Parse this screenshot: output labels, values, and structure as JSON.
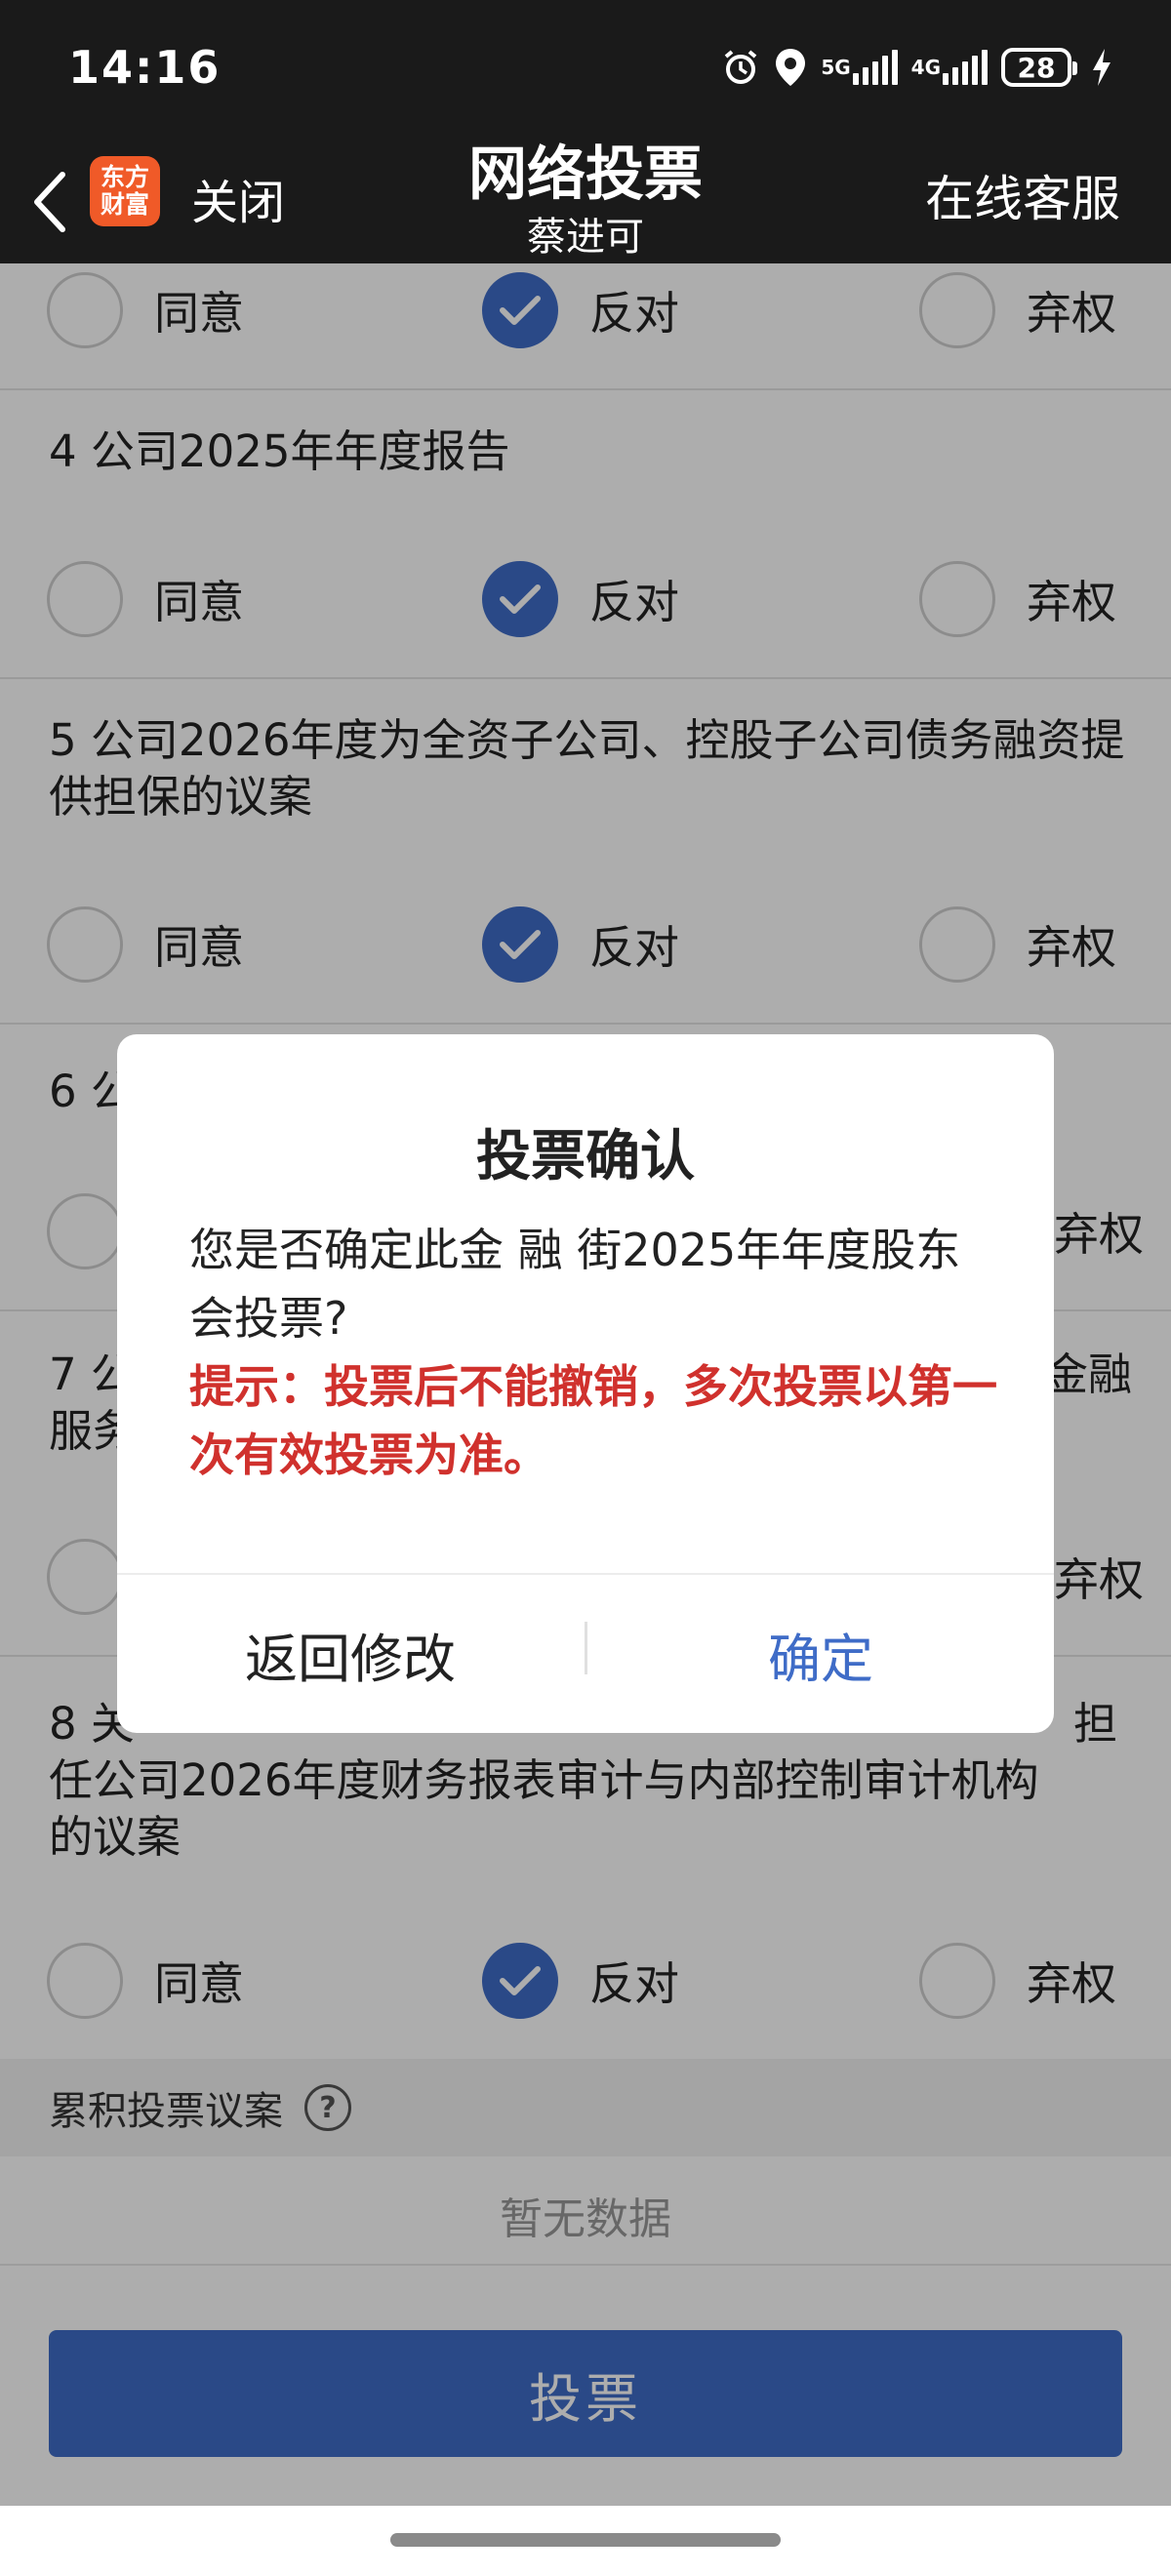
{
  "status_bar": {
    "time": "14:16",
    "network_5g": "5G",
    "network_4g": "4G",
    "battery": "28",
    "icons": [
      "alarm-icon",
      "location-icon",
      "signal-5g-icon",
      "signal-4g-icon",
      "battery-icon",
      "charging-icon"
    ]
  },
  "header": {
    "back_icon": "chevron-left-icon",
    "app_logo": "东方财富",
    "close_label": "关闭",
    "title": "网络投票",
    "subtitle": "蔡进可",
    "service_label": "在线客服"
  },
  "options": {
    "agree": "同意",
    "oppose": "反对",
    "abstain": "弃权"
  },
  "items": [
    {
      "title": "",
      "selected": "oppose"
    },
    {
      "title": "4 公司2025年年度报告",
      "selected": "oppose"
    },
    {
      "title": "5 公司2026年度为全资子公司、控股子公司债务融资提供担保的议案",
      "selected": "oppose"
    },
    {
      "title": "6 公",
      "selected": ""
    },
    {
      "title": "7 公",
      "title_line2": "服务",
      "title_right": "金融",
      "selected": ""
    },
    {
      "title": "8 关",
      "title_right": "担",
      "title_line2": "任公司2026年度财务报表审计与内部控制审计机构",
      "title_line3": "的议案",
      "selected": "oppose"
    }
  ],
  "partial_abstain_label": "弃权",
  "cumulative": {
    "label": "累积投票议案",
    "help_icon": "question-circle-icon",
    "help_glyph": "?",
    "empty_text": "暂无数据"
  },
  "submit_label": "投票",
  "dialog": {
    "title": "投票确认",
    "message": "您是否确定此金 融 街2025年年度股东会投票?",
    "tip": "提示：投票后不能撤销，多次投票以第一次有效投票为准。",
    "back_label": "返回修改",
    "confirm_label": "确定"
  },
  "colors": {
    "accent": "#3f6cc7",
    "warning": "#d0312d",
    "header_bg": "#1a1a1a",
    "logo": "#f05a28"
  }
}
